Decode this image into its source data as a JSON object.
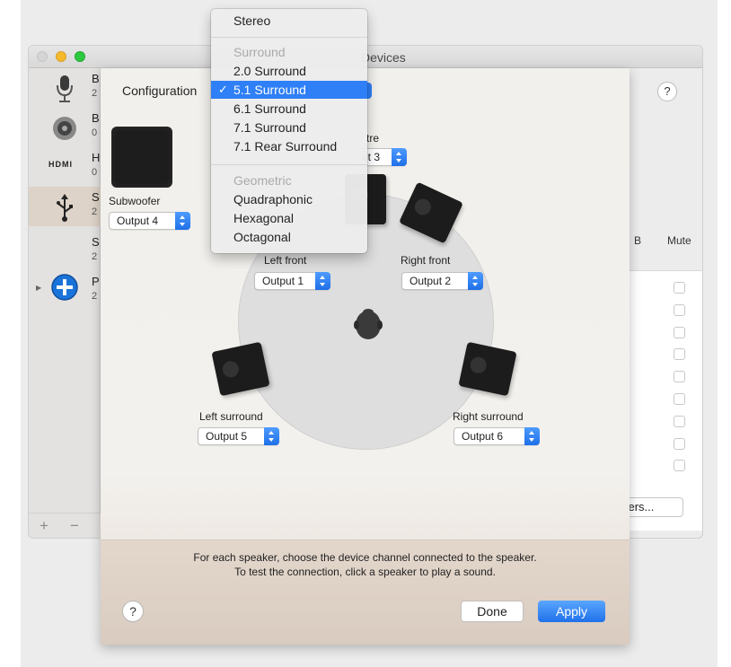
{
  "back_window": {
    "title": "Devices",
    "sidebar": [
      {
        "letter": "B",
        "sub": "2",
        "icon": "microphone-icon"
      },
      {
        "letter": "B",
        "sub": "0",
        "icon": "speaker-icon"
      },
      {
        "letter": "H",
        "sub": "0",
        "icon": "hdmi-icon",
        "icon_text": "HDMI"
      },
      {
        "letter": "S",
        "sub": "2",
        "icon": "usb-icon"
      },
      {
        "letter": "S",
        "sub": "2",
        "icon": ""
      },
      {
        "letter": "P",
        "sub": "2",
        "icon": "aggregate-plus-icon"
      }
    ],
    "add_label": "+",
    "remove_label": "−",
    "help_label": "?",
    "col_b_label": "B",
    "col_mute_label": "Mute",
    "speakers_button_label": "kers...",
    "mute_rows": 9
  },
  "sheet": {
    "configuration_label": "Configuration",
    "subwoofer": {
      "label": "Subwoofer",
      "output": "Output 4"
    },
    "centre": {
      "label": "tre",
      "output": "ut 3"
    },
    "left_front": {
      "label": "Left front",
      "output": "Output 1"
    },
    "right_front": {
      "label": "Right front",
      "output": "Output 2"
    },
    "left_surround": {
      "label": "Left surround",
      "output": "Output 5"
    },
    "right_surround": {
      "label": "Right surround",
      "output": "Output 6"
    },
    "description_line1": "For each speaker, choose the device channel connected to the speaker.",
    "description_line2": "To test the connection, click a speaker to play a sound.",
    "help_label": "?",
    "done_label": "Done",
    "apply_label": "Apply"
  },
  "menu": {
    "items": [
      {
        "label": "Stereo",
        "type": "item"
      },
      {
        "type": "separator"
      },
      {
        "label": "Surround",
        "type": "header"
      },
      {
        "label": "2.0 Surround",
        "type": "item"
      },
      {
        "label": "5.1 Surround",
        "type": "item",
        "selected": true,
        "check": "✓"
      },
      {
        "label": "6.1 Surround",
        "type": "item"
      },
      {
        "label": "7.1 Surround",
        "type": "item"
      },
      {
        "label": "7.1 Rear Surround",
        "type": "item"
      },
      {
        "type": "separator"
      },
      {
        "label": "Geometric",
        "type": "header"
      },
      {
        "label": "Quadraphonic",
        "type": "item"
      },
      {
        "label": "Hexagonal",
        "type": "item"
      },
      {
        "label": "Octagonal",
        "type": "item"
      }
    ]
  },
  "colors": {
    "accent": "#2f7ff6",
    "speaker": "#1c1c1c"
  }
}
